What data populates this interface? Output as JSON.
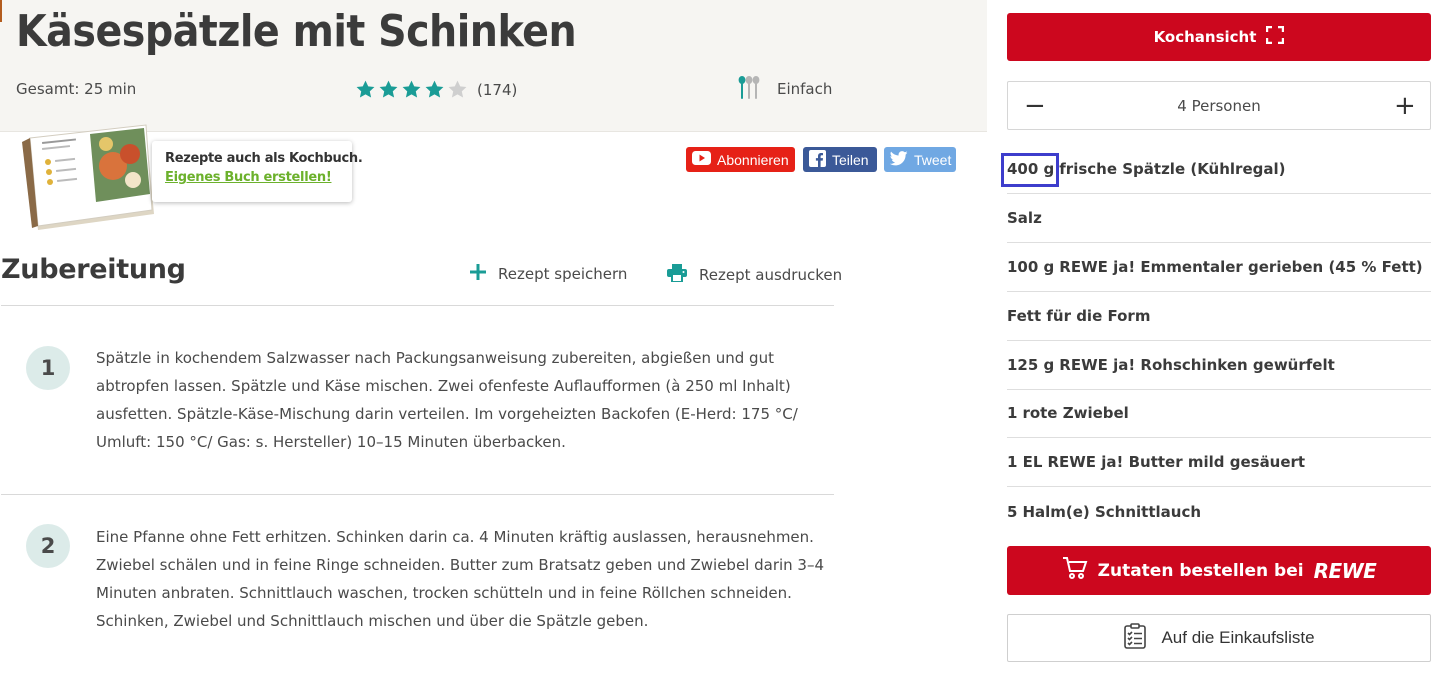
{
  "recipe": {
    "title": "Käsespätzle mit Schinken",
    "total_time": "Gesamt: 25 min",
    "rating_value": 4,
    "rating_max": 5,
    "rating_count": "(174)",
    "difficulty": "Einfach",
    "icons": {
      "difficulty": "spoons-icon",
      "star": "star-icon"
    }
  },
  "promo": {
    "title": "Rezepte auch als Kochbuch.",
    "link": "Eigenes Buch erstellen!"
  },
  "social": {
    "youtube": "Abonnieren",
    "facebook": "Teilen",
    "twitter": "Tweet"
  },
  "preparation": {
    "heading": "Zubereitung",
    "save_label": "Rezept speichern",
    "print_label": "Rezept ausdrucken",
    "steps": [
      {
        "number": "1",
        "text": "Spätzle in kochendem Salzwasser nach Packungsanweisung zubereiten, abgießen und gut abtropfen lassen. Spätzle und Käse mischen. Zwei ofenfeste Auflaufformen (à 250 ml Inhalt) ausfetten. Spätzle-Käse-Mischung darin verteilen. Im vorgeheizten Backofen (E-Herd: 175 °C/ Umluft: 150 °C/ Gas: s. Hersteller) 10–15 Minuten überbacken."
      },
      {
        "number": "2",
        "text": "Eine Pfanne ohne Fett erhitzen. Schinken darin ca. 4 Minuten kräftig auslassen, herausnehmen. Zwiebel schälen und in feine Ringe schneiden. Butter zum Bratsatz geben und Zwiebel darin 3–4 Minuten anbraten. Schnittlauch waschen, trocken schütteln und in feine Röllchen schneiden. Schinken, Zwiebel und Schnittlauch mischen und über die Spätzle geben."
      }
    ]
  },
  "sidebar": {
    "cook_view_label": "Kochansicht",
    "persons_label": "4 Personen",
    "minus": "−",
    "plus": "+",
    "ingredients": [
      {
        "amount": "400 g",
        "name": "frische Spätzle (Kühlregal)"
      },
      {
        "amount": "",
        "name": "Salz"
      },
      {
        "amount": "100 g",
        "name": "REWE ja! Emmentaler gerieben (45 % Fett)"
      },
      {
        "amount": "",
        "name": "Fett für die Form"
      },
      {
        "amount": "125 g",
        "name": "REWE ja! Rohschinken gewürfelt"
      },
      {
        "amount": "1",
        "name": "rote Zwiebel"
      },
      {
        "amount": "1 EL",
        "name": "REWE ja! Butter mild gesäuert"
      },
      {
        "amount": "5",
        "name": "Halm(e) Schnittlauch"
      }
    ],
    "order_label": "Zutaten bestellen bei",
    "order_brand": "REWE",
    "shopping_list_label": "Auf die Einkaufsliste"
  },
  "colors": {
    "accent_red": "#cc071e",
    "teal": "#1a9c96",
    "highlight_blue": "#3d3dcc",
    "promo_link_green": "#6cb12c"
  }
}
